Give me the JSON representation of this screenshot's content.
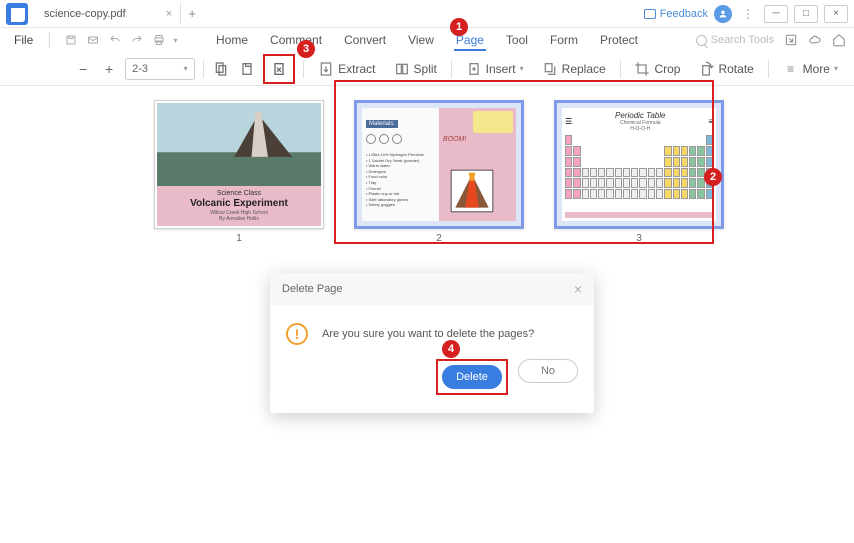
{
  "titlebar": {
    "tab_name": "science-copy.pdf",
    "feedback": "Feedback"
  },
  "menu": {
    "file": "File",
    "tabs": [
      "Home",
      "Comment",
      "Convert",
      "View",
      "Page",
      "Tool",
      "Form",
      "Protect"
    ],
    "search_placeholder": "Search Tools"
  },
  "toolbar": {
    "page_input": "2-3",
    "extract": "Extract",
    "split": "Split",
    "insert": "Insert",
    "replace": "Replace",
    "crop": "Crop",
    "rotate": "Rotate",
    "more": "More"
  },
  "thumbs": {
    "page1": {
      "num": "1",
      "subtitle": "Science Class",
      "title": "Volcanic Experiment",
      "school": "Willow Creek High School",
      "author": "By Annalise Hollis"
    },
    "page2": {
      "num": "2",
      "materials_label": "Materials:",
      "boom": "BOOM!"
    },
    "page3": {
      "num": "3",
      "title": "Periodic Table",
      "subtitle": "Chemical Formula",
      "formula": "H-O-O-H"
    }
  },
  "badges": {
    "b1": "1",
    "b2": "2",
    "b3": "3",
    "b4": "4"
  },
  "dialog": {
    "title": "Delete Page",
    "message": "Are you sure you want to delete the pages?",
    "delete": "Delete",
    "no": "No"
  }
}
